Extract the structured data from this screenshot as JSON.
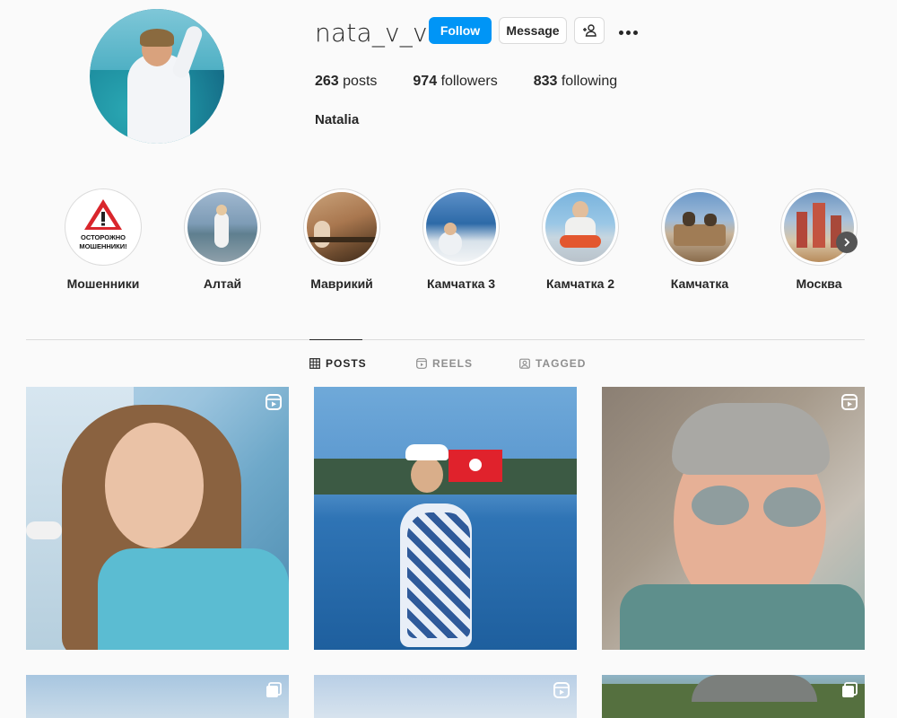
{
  "profile": {
    "username": "nata_v_v",
    "full_name": "Natalia",
    "follow_label": "Follow",
    "message_label": "Message",
    "suggest_icon": "person-add-icon",
    "more_icon": "more-horizontal-icon",
    "stats": {
      "posts_count": "263",
      "posts_label": "posts",
      "followers_count": "974",
      "followers_label": "followers",
      "following_count": "833",
      "following_label": "following"
    }
  },
  "highlights": [
    {
      "label": "Мошенники",
      "sign_text": "ОСТОРОЖНО МОШЕННИКИ!"
    },
    {
      "label": "Алтай"
    },
    {
      "label": "Маврикий"
    },
    {
      "label": "Камчатка 3"
    },
    {
      "label": "Камчатка 2"
    },
    {
      "label": "Камчатка"
    },
    {
      "label": "Москва"
    }
  ],
  "tabs": [
    {
      "label": "POSTS",
      "icon": "grid-icon",
      "active": true
    },
    {
      "label": "REELS",
      "icon": "reels-icon",
      "active": false
    },
    {
      "label": "TAGGED",
      "icon": "tagged-icon",
      "active": false
    }
  ],
  "posts": [
    {
      "type": "reel"
    },
    {
      "type": "photo"
    },
    {
      "type": "reel"
    },
    {
      "type": "carousel"
    },
    {
      "type": "reel"
    },
    {
      "type": "carousel"
    }
  ],
  "colors": {
    "accent": "#0095f6",
    "text": "#262626",
    "muted": "#8e8e8e",
    "border": "#dbdbdb",
    "background": "#fafafa"
  }
}
